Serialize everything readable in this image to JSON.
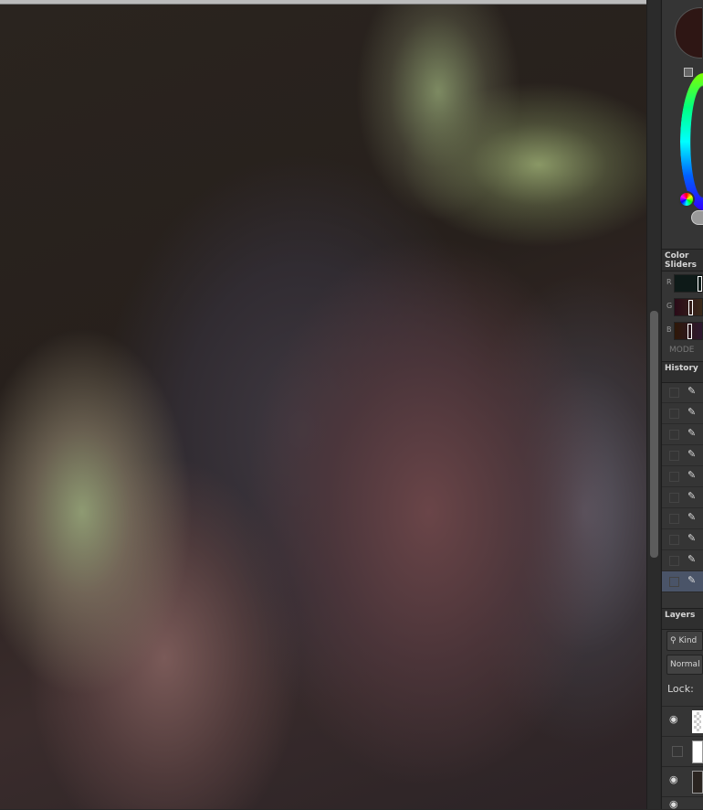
{
  "panels": {
    "color_sliders": {
      "title": "Color Sliders",
      "channels": [
        "R",
        "G",
        "B"
      ],
      "mode_label": "MODE"
    },
    "history": {
      "title": "History",
      "items": [
        {
          "icon": "brush-icon"
        },
        {
          "icon": "brush-icon"
        },
        {
          "icon": "brush-icon"
        },
        {
          "icon": "brush-icon"
        },
        {
          "icon": "brush-icon"
        },
        {
          "icon": "brush-icon"
        },
        {
          "icon": "brush-icon"
        },
        {
          "icon": "brush-icon"
        },
        {
          "icon": "brush-icon"
        },
        {
          "icon": "brush-icon",
          "selected": true
        }
      ]
    },
    "layers": {
      "title": "Layers",
      "filter_label": "Kind",
      "blend_mode": "Normal",
      "lock_label": "Lock:"
    }
  },
  "colors": {
    "foreground": "#2e1614",
    "accent_selected": "#4a5468"
  }
}
